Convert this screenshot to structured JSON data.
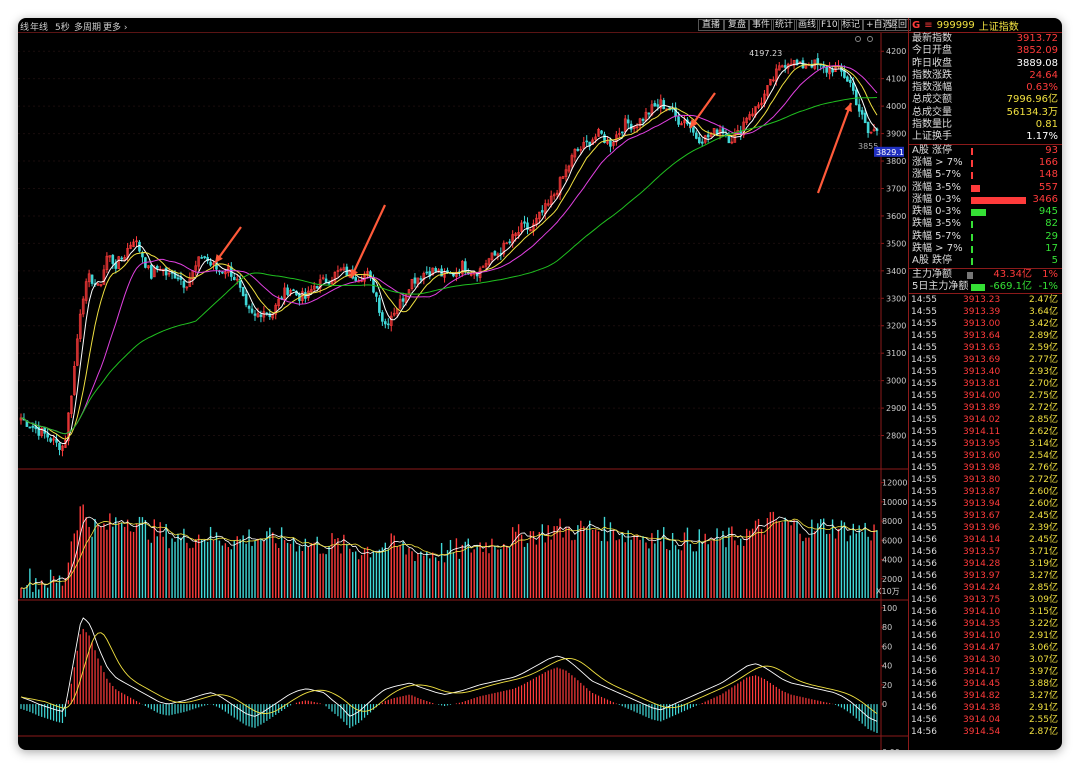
{
  "toolbar_left": [
    "线",
    "年线",
    "5秒",
    "多周期",
    "更多 ›"
  ],
  "toolbar_right": [
    "直播",
    "复盘",
    "事件",
    "统计",
    "画线",
    "F10",
    "标记",
    "+自选",
    "返回"
  ],
  "symbol": {
    "flag": "G",
    "menu": "≡",
    "code": "999999",
    "name": "上证指数"
  },
  "stats": [
    {
      "label": "最新指数",
      "value": "3913.72",
      "color": "red"
    },
    {
      "label": "今日开盘",
      "value": "3852.09",
      "color": "red"
    },
    {
      "label": "昨日收盘",
      "value": "3889.08",
      "color": "wht"
    },
    {
      "label": "指数涨跌",
      "value": "24.64",
      "color": "red"
    },
    {
      "label": "指数涨幅",
      "value": "0.63%",
      "color": "red"
    },
    {
      "label": "总成交额",
      "value": "7996.96亿",
      "color": "yel"
    },
    {
      "label": "总成交量",
      "value": "56134.3万",
      "color": "yel"
    },
    {
      "label": "指数量比",
      "value": "0.81",
      "color": "yel"
    },
    {
      "label": "上证换手",
      "value": "1.17%",
      "color": "wht"
    }
  ],
  "breadth": [
    {
      "label": "A股 涨停",
      "value": "93",
      "color": "red",
      "level": 0.02
    },
    {
      "label": "涨幅 > 7%",
      "value": "166",
      "color": "red",
      "level": 0.04
    },
    {
      "label": "涨幅 5-7%",
      "value": "148",
      "color": "red",
      "level": 0.035
    },
    {
      "label": "涨幅 3-5%",
      "value": "557",
      "color": "red",
      "level": 0.16
    },
    {
      "label": "涨幅 0-3%",
      "value": "3466",
      "color": "red",
      "level": 1.0
    },
    {
      "label": "跌幅 0-3%",
      "value": "945",
      "color": "grn",
      "level": 0.27
    },
    {
      "label": "跌幅 3-5%",
      "value": "82",
      "color": "grn",
      "level": 0.02
    },
    {
      "label": "跌幅 5-7%",
      "value": "29",
      "color": "grn",
      "level": 0.01
    },
    {
      "label": "跌幅 > 7%",
      "value": "17",
      "color": "grn",
      "level": 0.005
    },
    {
      "label": "A股 跌停",
      "value": "5",
      "color": "grn",
      "level": 0.002
    }
  ],
  "flow": [
    {
      "label": "主力净额",
      "value": "43.34亿",
      "pct": "1%",
      "color": "red"
    },
    {
      "label": "5日主力净额",
      "value": "-669.1亿",
      "pct": "-1%",
      "color": "grn"
    }
  ],
  "ticks": [
    [
      "14:55",
      "3913.23",
      "2.47亿"
    ],
    [
      "14:55",
      "3913.39",
      "3.64亿"
    ],
    [
      "14:55",
      "3913.00",
      "3.42亿"
    ],
    [
      "14:55",
      "3913.64",
      "2.89亿"
    ],
    [
      "14:55",
      "3913.63",
      "2.59亿"
    ],
    [
      "14:55",
      "3913.69",
      "2.77亿"
    ],
    [
      "14:55",
      "3913.40",
      "2.93亿"
    ],
    [
      "14:55",
      "3913.81",
      "2.70亿"
    ],
    [
      "14:55",
      "3914.00",
      "2.75亿"
    ],
    [
      "14:55",
      "3913.89",
      "2.72亿"
    ],
    [
      "14:55",
      "3914.02",
      "2.85亿"
    ],
    [
      "14:55",
      "3914.11",
      "2.62亿"
    ],
    [
      "14:55",
      "3913.95",
      "3.14亿"
    ],
    [
      "14:55",
      "3913.60",
      "2.54亿"
    ],
    [
      "14:55",
      "3913.98",
      "2.76亿"
    ],
    [
      "14:55",
      "3913.80",
      "2.72亿"
    ],
    [
      "14:55",
      "3913.87",
      "2.60亿"
    ],
    [
      "14:55",
      "3913.94",
      "2.60亿"
    ],
    [
      "14:55",
      "3913.67",
      "2.45亿"
    ],
    [
      "14:55",
      "3913.96",
      "2.39亿"
    ],
    [
      "14:56",
      "3914.14",
      "2.45亿"
    ],
    [
      "14:56",
      "3913.57",
      "3.71亿"
    ],
    [
      "14:56",
      "3914.28",
      "3.19亿"
    ],
    [
      "14:56",
      "3913.97",
      "3.27亿"
    ],
    [
      "14:56",
      "3914.24",
      "2.85亿"
    ],
    [
      "14:56",
      "3913.75",
      "3.09亿"
    ],
    [
      "14:56",
      "3914.10",
      "3.15亿"
    ],
    [
      "14:56",
      "3914.35",
      "3.22亿"
    ],
    [
      "14:56",
      "3914.10",
      "2.91亿"
    ],
    [
      "14:56",
      "3914.47",
      "3.06亿"
    ],
    [
      "14:56",
      "3914.30",
      "3.07亿"
    ],
    [
      "14:56",
      "3914.17",
      "3.97亿"
    ],
    [
      "14:56",
      "3914.45",
      "3.88亿"
    ],
    [
      "14:56",
      "3914.82",
      "3.27亿"
    ],
    [
      "14:56",
      "3914.38",
      "2.91亿"
    ],
    [
      "14:56",
      "3914.04",
      "2.55亿"
    ],
    [
      "14:56",
      "3914.54",
      "2.87亿"
    ]
  ],
  "chart_data": [
    {
      "type": "candlestick",
      "ylim": [
        2700,
        4230
      ],
      "yticks": [
        4200,
        4100,
        4000,
        3900,
        3800,
        3700,
        3600,
        3500,
        3400,
        3300,
        3200,
        3100,
        3000,
        2900,
        2800
      ],
      "annotations": [
        {
          "text": "4197.23",
          "value": 4197.23
        },
        {
          "text": "3855",
          "value": 3855
        }
      ],
      "current_price_label": "3829.1",
      "anchors": [
        2865,
        2840,
        2818,
        2800,
        2770,
        2760,
        3000,
        3300,
        3380,
        3330,
        3460,
        3420,
        3460,
        3520,
        3460,
        3380,
        3420,
        3380,
        3390,
        3350,
        3400,
        3460,
        3420,
        3400,
        3410,
        3360,
        3260,
        3230,
        3260,
        3240,
        3300,
        3340,
        3310,
        3300,
        3350,
        3360,
        3380,
        3400,
        3390,
        3380,
        3390,
        3320,
        3200,
        3250,
        3290,
        3360,
        3380,
        3400,
        3400,
        3380,
        3390,
        3420,
        3400,
        3400,
        3440,
        3460,
        3490,
        3520,
        3560,
        3550,
        3600,
        3640,
        3700,
        3760,
        3830,
        3850,
        3880,
        3900,
        3860,
        3900,
        3940,
        3930,
        3960,
        3990,
        4010,
        3990,
        3950,
        3950,
        3890,
        3880,
        3900,
        3920,
        3880,
        3900,
        3970,
        3990,
        4040,
        4100,
        4150,
        4170,
        4140,
        4160,
        4150,
        4130,
        4140,
        4120,
        4080,
        3980,
        3900,
        3915
      ],
      "ma_colors": [
        "#ffffff",
        "#f0e040",
        "#e040e0",
        "#20c020"
      ]
    },
    {
      "type": "bar",
      "name": "volume",
      "unit_label": "X10万",
      "yticks": [
        12000,
        10000,
        8000,
        6000,
        4000,
        2000
      ],
      "ylim": [
        0,
        13000
      ],
      "anchors": [
        2200,
        2000,
        1800,
        1900,
        1700,
        1800,
        6800,
        9500,
        7800,
        7000,
        7500,
        7900,
        8400,
        8100,
        7500,
        7000,
        6800,
        6500,
        6300,
        6200,
        6400,
        6700,
        6300,
        6200,
        6100,
        6000,
        6300,
        6400,
        6200,
        6000,
        6100,
        6000,
        5900,
        5700,
        5600,
        5500,
        5700,
        5400,
        5200,
        5000,
        5100,
        5300,
        5600,
        5400,
        5200,
        4900,
        4800,
        4700,
        4800,
        4700,
        4900,
        5000,
        5300,
        5500,
        5700,
        5900,
        6100,
        6300,
        6500,
        6700,
        6800,
        7000,
        7200,
        7100,
        7000,
        7200,
        7300,
        7200,
        7100,
        6900,
        6700,
        6600,
        6500,
        6400,
        6300,
        6200,
        6100,
        6100,
        6000,
        5900,
        6000,
        6100,
        6200,
        6300,
        6700,
        7100,
        7600,
        8000,
        7800,
        7500,
        7300,
        7100,
        7300,
        7600,
        7400,
        7200,
        7000,
        7200,
        7000,
        6900
      ]
    },
    {
      "type": "bar",
      "name": "macd",
      "yticks": [
        100.0,
        80.0,
        60.0,
        40.0,
        20.0,
        0.0
      ],
      "ylim": [
        -30,
        105
      ],
      "anchors": [
        -5,
        -8,
        -12,
        -15,
        -18,
        -20,
        30,
        80,
        70,
        45,
        25,
        15,
        10,
        5,
        0,
        -5,
        -10,
        -12,
        -10,
        -8,
        -5,
        -2,
        0,
        -4,
        -10,
        -16,
        -22,
        -25,
        -20,
        -14,
        -8,
        -2,
        2,
        4,
        2,
        0,
        -8,
        -15,
        -25,
        -20,
        -12,
        -4,
        3,
        6,
        8,
        10,
        6,
        3,
        0,
        -2,
        0,
        2,
        5,
        8,
        10,
        12,
        14,
        16,
        20,
        25,
        30,
        35,
        38,
        35,
        28,
        20,
        12,
        8,
        4,
        0,
        -4,
        -8,
        -12,
        -16,
        -18,
        -14,
        -10,
        -6,
        -2,
        2,
        6,
        10,
        16,
        22,
        28,
        30,
        26,
        20,
        14,
        10,
        8,
        6,
        4,
        2,
        0,
        -4,
        -10,
        -18,
        -26,
        -30
      ],
      "bottom_label": "0.00"
    }
  ]
}
